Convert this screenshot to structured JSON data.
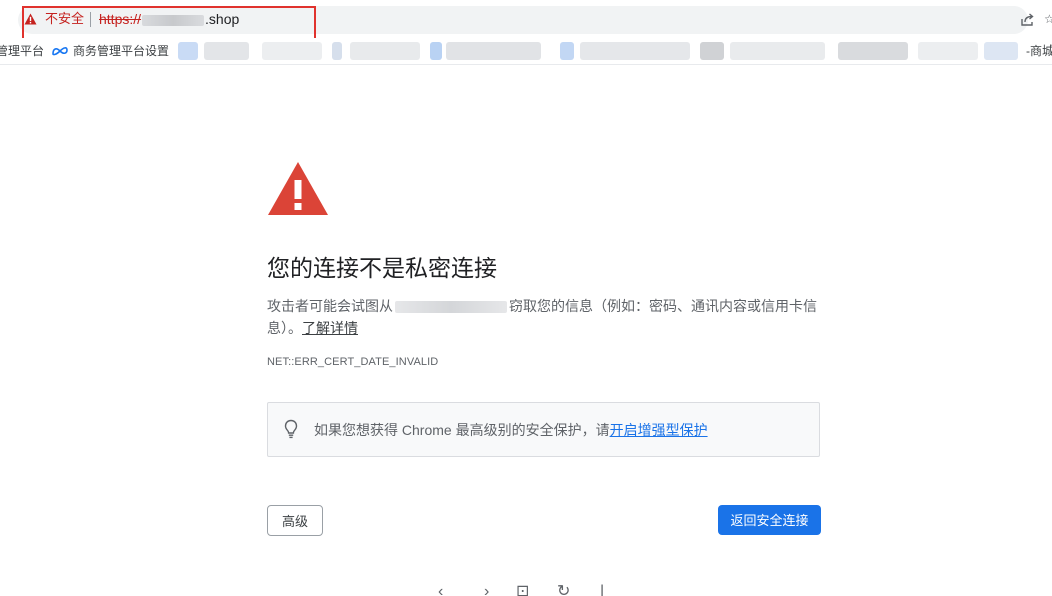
{
  "address_bar": {
    "security_label": "不安全",
    "url_scheme": "https://",
    "url_suffix": ".shop"
  },
  "bookmarks": {
    "left_partial_label": "管理平台",
    "second_label": "商务管理平台设置",
    "right_partial_label": "-商城"
  },
  "page": {
    "heading": "您的连接不是私密连接",
    "body_before_host": "攻击者可能会试图从",
    "body_after_host": "窃取您的信息（例如：密码、通讯内容或信用卡信息）。",
    "learn_more_link": "了解详情",
    "error_code": "NET::ERR_CERT_DATE_INVALID",
    "enhanced_protection_text": "如果您想获得 Chrome 最高级别的安全保护，请",
    "enhanced_protection_link": "开启增强型保护"
  },
  "buttons": {
    "advanced_label": "高级",
    "back_to_safety_label": "返回安全连接"
  },
  "colors": {
    "warning_red": "#db4437",
    "not_secure_red": "#c5221f",
    "primary_blue": "#1a73e8",
    "highlight_red": "#e0322d"
  }
}
